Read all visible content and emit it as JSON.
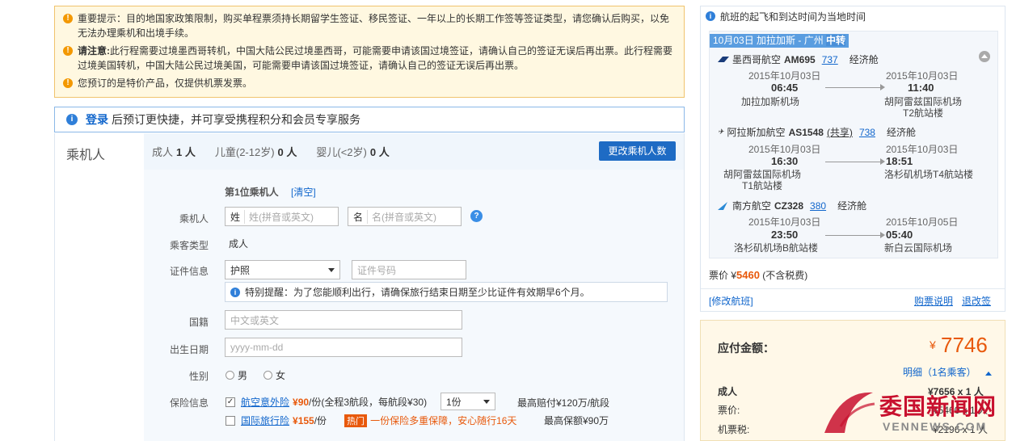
{
  "notice": {
    "items": [
      {
        "prefix": "",
        "text": "重要提示：目的地国家政策限制，购买单程票须持长期留学生签证、移民签证、一年以上的长期工作签等签证类型，请您确认后购买，以免无法办理乘机和出境手续。"
      },
      {
        "prefix": "请注意:",
        "text": "此行程需要过境墨西哥转机，中国大陆公民过境墨西哥，可能需要申请该国过境签证，请确认自己的签证无误后再出票。此行程需要过境美国转机，中国大陆公民过境美国，可能需要申请该国过境签证，请确认自己的签证无误后再出票。"
      },
      {
        "prefix": "",
        "text": "您预订的是特价产品，仅提供机票发票。"
      }
    ]
  },
  "login_bar": {
    "link": "登录",
    "text": "后预订更快捷，并可享受携程积分和会员专享服务"
  },
  "passenger": {
    "section_title": "乘机人",
    "counts": [
      {
        "label": "成人",
        "value": "1 人"
      },
      {
        "label": "儿童(2-12岁)",
        "value": "0 人"
      },
      {
        "label": "婴儿(<2岁)",
        "value": "0 人"
      }
    ],
    "change_button": "更改乘机人数",
    "first_title": "第1位乘机人",
    "clear": "[清空]",
    "name_label": "乘机人",
    "surname_pre": "姓",
    "surname_placeholder": "姓(拼音或英文)",
    "given_pre": "名",
    "given_placeholder": "名(拼音或英文)",
    "type_label": "乘客类型",
    "type_value": "成人",
    "id_label": "证件信息",
    "id_type": "护照",
    "id_placeholder": "证件号码",
    "tip": "特别提醒：为了您能顺利出行，请确保旅行结束日期至少比证件有效期早6个月。",
    "nationality_label": "国籍",
    "nationality_placeholder": "中文或英文",
    "birth_label": "出生日期",
    "birth_placeholder": "yyyy-mm-dd",
    "gender_label": "性别",
    "gender_male": "男",
    "gender_female": "女",
    "insurance_label": "保险信息",
    "ins1_name": "航空意外险",
    "ins1_price": "¥90",
    "ins1_desc": "/份(全程3航段，每航段¥30)",
    "ins1_qty": "1份",
    "ins1_max": "最高赔付¥120万/航段",
    "ins2_name": "国际旅行险",
    "ins2_price": "¥155",
    "ins2_unit": "/份",
    "ins2_tag": "热门",
    "ins2_promo": "一份保险多重保障，安心随行16天",
    "ins2_max": "最高保额¥90万"
  },
  "flight": {
    "header": "航班的起飞和到达时间为当地时间",
    "segment_title": "10月03日 加拉加斯 - 广州",
    "transfer": "中转",
    "legs": [
      {
        "airline": "墨西哥航空",
        "code": "AM695",
        "model": "737",
        "share": "",
        "cabin": "经济舱",
        "dep_date": "2015年10月03日",
        "dep_time": "06:45",
        "dep_airport": "加拉加斯机场",
        "arr_date": "2015年10月03日",
        "arr_time": "11:40",
        "arr_airport": "胡阿雷兹国际机场T2航站楼"
      },
      {
        "airline": "阿拉斯加航空",
        "code": "AS1548",
        "model": "738",
        "share": "(共享)",
        "cabin": "经济舱",
        "dep_date": "2015年10月03日",
        "dep_time": "16:30",
        "dep_airport": "胡阿雷兹国际机场T1航站楼",
        "arr_date": "2015年10月03日",
        "arr_time": "18:51",
        "arr_airport": "洛杉矶机场T4航站楼"
      },
      {
        "airline": "南方航空",
        "code": "CZ328",
        "model": "380",
        "share": "",
        "cabin": "经济舱",
        "dep_date": "2015年10月03日",
        "dep_time": "23:50",
        "dep_airport": "洛杉矶机场B航站楼",
        "arr_date": "2015年10月05日",
        "arr_time": "05:40",
        "arr_airport": "新白云国际机场"
      }
    ],
    "price_label": "票价 ¥",
    "price_value": "5460",
    "price_note": "(不含税费)",
    "modify": "[修改航班]",
    "ticket_info": "购票说明",
    "refund": "退改签"
  },
  "payment": {
    "label": "应付金额：",
    "currency": "¥",
    "amount": "7746",
    "detail": "明细（1名乘客）",
    "adult_label": "成人",
    "adult_value": "¥7656 x 1 人",
    "fare_label": "票价:",
    "fare_value": "¥5460 x 1 人",
    "tax_label": "机票税:",
    "tax_value": "¥2196 x 1 人"
  },
  "watermark": {
    "title": "委国新闻网",
    "sub": "VENNEWS.COM"
  },
  "colors": {
    "accent": "#1e6bc4",
    "price": "#e8590c",
    "warn": "#f39800"
  }
}
